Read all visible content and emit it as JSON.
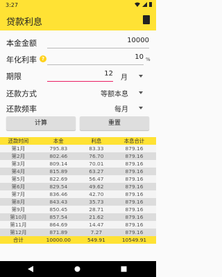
{
  "status": {
    "time": "3:27"
  },
  "app": {
    "title": "贷款利息",
    "calc_icon": "calculator-icon"
  },
  "form": {
    "amount": {
      "label": "本金金额",
      "value": "10000"
    },
    "rate": {
      "label": "年化利率",
      "value": "10",
      "unit": "%",
      "help_icon": "?"
    },
    "term": {
      "label": "期限",
      "value": "12",
      "unit": "月"
    },
    "method": {
      "label": "还款方式",
      "value": "等额本息"
    },
    "frequency": {
      "label": "还款频率",
      "value": "每月"
    }
  },
  "buttons": {
    "calculate": "计算",
    "reset": "重置"
  },
  "table": {
    "headers": [
      "还款时间",
      "本金",
      "利息",
      "本息合计"
    ],
    "rows": [
      [
        "第1月",
        "795.83",
        "83.33",
        "879.16"
      ],
      [
        "第2月",
        "802.46",
        "76.70",
        "879.16"
      ],
      [
        "第3月",
        "809.14",
        "70.01",
        "879.16"
      ],
      [
        "第4月",
        "815.89",
        "63.27",
        "879.16"
      ],
      [
        "第5月",
        "822.69",
        "56.47",
        "879.16"
      ],
      [
        "第6月",
        "829.54",
        "49.62",
        "879.16"
      ],
      [
        "第7月",
        "836.46",
        "42.70",
        "879.16"
      ],
      [
        "第8月",
        "843.43",
        "35.73",
        "879.16"
      ],
      [
        "第9月",
        "850.45",
        "28.71",
        "879.16"
      ],
      [
        "第10月",
        "857.54",
        "21.62",
        "879.16"
      ],
      [
        "第11月",
        "864.69",
        "14.47",
        "879.16"
      ],
      [
        "第12月",
        "871.89",
        "7.27",
        "879.16"
      ]
    ],
    "footer": [
      "合计",
      "10000.00",
      "549.91",
      "10549.91"
    ]
  },
  "colors": {
    "accent": "#ffe234",
    "stripe": "#dcdcdc",
    "term_underline": "#e91e63"
  }
}
